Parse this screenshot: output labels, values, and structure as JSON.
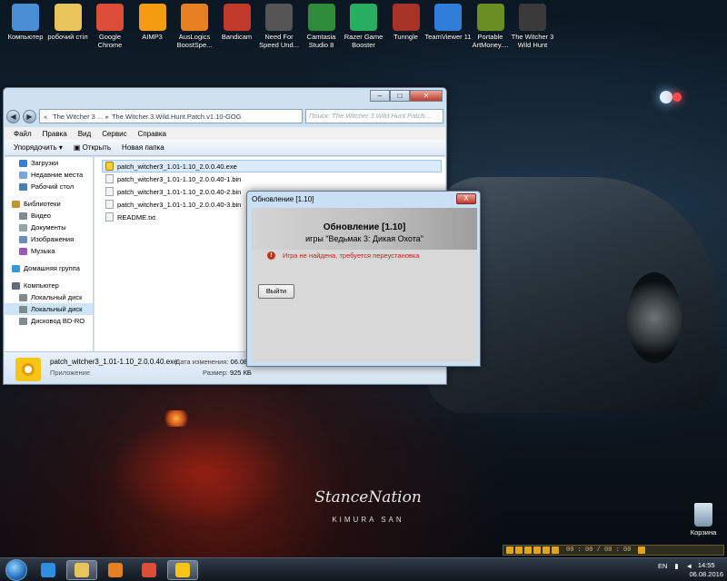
{
  "desktop_icons": [
    {
      "label": "Компьютер",
      "icon": "computer-icon",
      "color": "#4a8fd4"
    },
    {
      "label": "робочий стіл",
      "icon": "folder-icon",
      "color": "#e8c45a"
    },
    {
      "label": "Google Chrome",
      "icon": "chrome-icon",
      "color": "#dd4b39"
    },
    {
      "label": "AIMP3",
      "icon": "aimp-icon",
      "color": "#f39c12"
    },
    {
      "label": "AusLogics BoostSpe...",
      "icon": "auslogics-icon",
      "color": "#e67e22"
    },
    {
      "label": "Bandicam",
      "icon": "bandicam-icon",
      "color": "#c0392b"
    },
    {
      "label": "Need For Speed Und...",
      "icon": "nfs-icon",
      "color": "#555555"
    },
    {
      "label": "Camtasia Studio 8",
      "icon": "camtasia-icon",
      "color": "#2e8b3a"
    },
    {
      "label": "Razer Game Booster",
      "icon": "razer-icon",
      "color": "#27ae60"
    },
    {
      "label": "Tunngle",
      "icon": "tunngle-icon",
      "color": "#a93226"
    },
    {
      "label": "TeamViewer 11",
      "icon": "teamviewer-icon",
      "color": "#2f7fd8"
    },
    {
      "label": "Portable ArtMoney....",
      "icon": "artmoney-icon",
      "color": "#6b8e23"
    },
    {
      "label": "The Witcher 3 Wild Hunt",
      "icon": "witcher-icon",
      "color": "#3a3a3a"
    }
  ],
  "explorer": {
    "breadcrumb": [
      "The Witcher 3 ...",
      "The.Witcher.3.Wild.Hunt.Patch.v1.10-GOG"
    ],
    "search_placeholder": "Поиск: The.Witcher.3.Wild.Hunt.Patch....",
    "menu": [
      "Файл",
      "Правка",
      "Вид",
      "Сервис",
      "Справка"
    ],
    "toolbar": {
      "organize": "Упорядочить ▾",
      "open": "Открыть",
      "new_folder": "Новая папка"
    },
    "nav": [
      {
        "label": "Загрузки",
        "group": false,
        "color": "#3a7bd5"
      },
      {
        "label": "Недавние места",
        "group": false,
        "color": "#7aa7d9"
      },
      {
        "label": "Рабочий стол",
        "group": false,
        "color": "#4a7fb5"
      },
      {
        "label": "Библиотеки",
        "group": true,
        "color": "#c5962e"
      },
      {
        "label": "Видео",
        "group": false,
        "color": "#7f8c8d"
      },
      {
        "label": "Документы",
        "group": false,
        "color": "#95a5a6"
      },
      {
        "label": "Изображения",
        "group": false,
        "color": "#6c8ebf"
      },
      {
        "label": "Музыка",
        "group": false,
        "color": "#9b59b6"
      },
      {
        "label": "Домашняя группа",
        "group": true,
        "color": "#3498db"
      },
      {
        "label": "Компьютер",
        "group": true,
        "color": "#5d6d7e"
      },
      {
        "label": "Локальный диск",
        "group": false,
        "color": "#7f8c8d"
      },
      {
        "label": "Локальный диск",
        "group": false,
        "color": "#7f8c8d",
        "selected": true
      },
      {
        "label": "Дисковод BD-RO",
        "group": false,
        "color": "#7f8c8d"
      }
    ],
    "files": [
      {
        "name": "patch_witcher3_1.01-1.10_2.0.0.40.exe",
        "type": "exe",
        "selected": true
      },
      {
        "name": "patch_witcher3_1.01-1.10_2.0.0.40-1.bin",
        "type": "bin"
      },
      {
        "name": "patch_witcher3_1.01-1.10_2.0.0.40-2.bin",
        "type": "bin"
      },
      {
        "name": "patch_witcher3_1.01-1.10_2.0.0.40-3.bin",
        "type": "bin"
      },
      {
        "name": "README.txt",
        "type": "txt"
      }
    ],
    "status": {
      "name": "patch_witcher3_1.01-1.10_2.0.0.40.exe",
      "type": "Приложение",
      "date_label": "Дата изменения:",
      "date_value": "06.08.",
      "size_label": "Размер:",
      "size_value": "925 КБ"
    }
  },
  "dialog": {
    "title": "Обновление [1.10]",
    "close": "X",
    "heading": "Обновление [1.10]",
    "subheading": "игры \"Ведьмак 3: Дикая Охота\"",
    "error_icon": "!",
    "error_text": "Игра не найдена, требуется переустановка",
    "exit_button": "Выйти"
  },
  "recycle_bin": {
    "label": "Корзина"
  },
  "watermark": {
    "logo": "StanceNation",
    "sub": "KIMURA SAN"
  },
  "player": {
    "time": "00 : 00 / 00 : 00"
  },
  "taskbar": {
    "apps": [
      {
        "icon": "ie-icon",
        "color": "#2f8de4"
      },
      {
        "icon": "explorer-folder-icon",
        "color": "#e8c45a",
        "active": true
      },
      {
        "icon": "media-player-icon",
        "color": "#e67e22"
      },
      {
        "icon": "chrome-icon",
        "color": "#dd4b39"
      },
      {
        "icon": "patch-app-icon",
        "color": "#f5c518",
        "active": true
      }
    ],
    "lang": "EN",
    "time": "14:55",
    "date": "06.08.2016"
  }
}
